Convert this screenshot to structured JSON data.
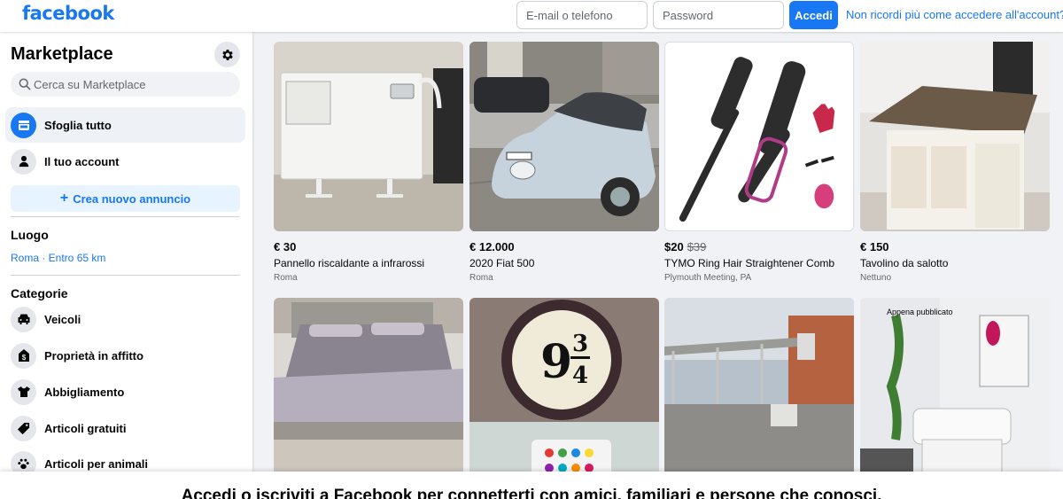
{
  "header": {
    "logo": "facebook",
    "email_placeholder": "E-mail o telefono",
    "password_placeholder": "Password",
    "login_label": "Accedi",
    "forgot_label": "Non ricordi più come accedere all'account?"
  },
  "sidebar": {
    "title": "Marketplace",
    "search_placeholder": "Cerca su Marketplace",
    "nav": [
      {
        "label": "Sfoglia tutto",
        "icon": "storefront-icon",
        "active": true
      },
      {
        "label": "Il tuo account",
        "icon": "person-icon",
        "active": false
      }
    ],
    "create_label": "Crea nuovo annuncio",
    "location_title": "Luogo",
    "location_value": "Roma · Entro 65 km",
    "categories_title": "Categorie",
    "categories": [
      {
        "label": "Veicoli",
        "icon": "car-icon"
      },
      {
        "label": "Proprietà in affitto",
        "icon": "rent-house-icon"
      },
      {
        "label": "Abbigliamento",
        "icon": "shirt-icon"
      },
      {
        "label": "Articoli gratuiti",
        "icon": "tag-icon"
      },
      {
        "label": "Articoli per animali",
        "icon": "paw-icon"
      }
    ]
  },
  "listings": [
    {
      "price": "€ 30",
      "old_price": "",
      "title": "Pannello riscaldante a infrarossi",
      "location": "Roma",
      "badge": ""
    },
    {
      "price": "€ 12.000",
      "old_price": "",
      "title": "2020 Fiat 500",
      "location": "Roma",
      "badge": ""
    },
    {
      "price": "$20",
      "old_price": "$39",
      "title": "TYMO Ring Hair Straightener Comb",
      "location": "Plymouth Meeting, PA",
      "badge": ""
    },
    {
      "price": "€ 150",
      "old_price": "",
      "title": "Tavolino da salotto",
      "location": "Nettuno",
      "badge": ""
    },
    {
      "price": "",
      "old_price": "",
      "title": "",
      "location": "",
      "badge": ""
    },
    {
      "price": "",
      "old_price": "",
      "title": "",
      "location": "",
      "badge": ""
    },
    {
      "price": "",
      "old_price": "",
      "title": "",
      "location": "",
      "badge": ""
    },
    {
      "price": "",
      "old_price": "",
      "title": "",
      "location": "",
      "badge": "Appena pubblicato"
    }
  ],
  "banner": {
    "text": "Accedi o iscriviti a Facebook per connetterti con amici, familiari e persone che conosci."
  },
  "colors": {
    "brand": "#1877f2",
    "page_bg": "#f0f2f5"
  }
}
